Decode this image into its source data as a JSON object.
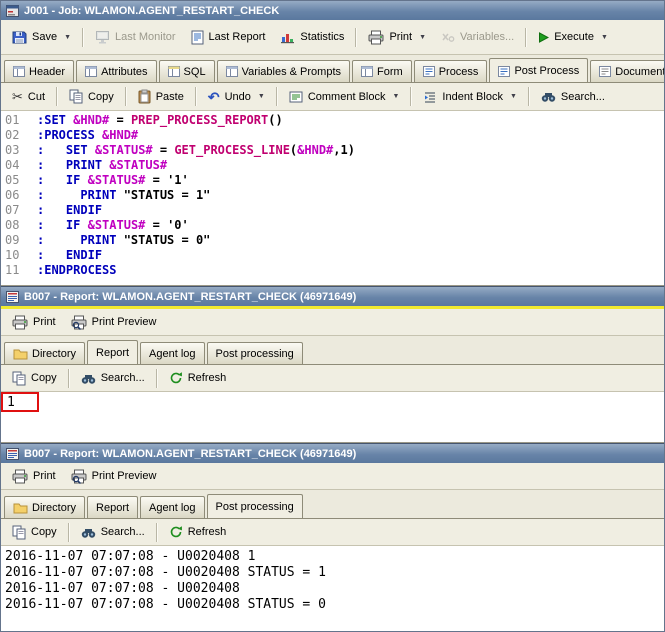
{
  "titlebar": {
    "title": "J001 - Job: WLAMON.AGENT_RESTART_CHECK"
  },
  "main_toolbar": {
    "save": "Save",
    "last_monitor": "Last Monitor",
    "last_report": "Last Report",
    "statistics": "Statistics",
    "print": "Print",
    "variables": "Variables...",
    "execute": "Execute"
  },
  "job_tabs": [
    {
      "label": "Header"
    },
    {
      "label": "Attributes"
    },
    {
      "label": "SQL"
    },
    {
      "label": "Variables & Prompts"
    },
    {
      "label": "Form"
    },
    {
      "label": "Process"
    },
    {
      "label": "Post Process"
    },
    {
      "label": "Documentation"
    }
  ],
  "job_tabs_active": "Post Process",
  "editor_toolbar": {
    "cut": "Cut",
    "copy": "Copy",
    "paste": "Paste",
    "undo": "Undo",
    "comment_block": "Comment Block",
    "indent_block": "Indent Block",
    "search": "Search..."
  },
  "editor": {
    "lines": [
      {
        "no": "01",
        "seg": [
          {
            "t": ":SET",
            "c": "kw"
          },
          {
            "t": " ",
            "c": "pl"
          },
          {
            "t": "&HND#",
            "c": "var"
          },
          {
            "t": " = ",
            "c": "pl"
          },
          {
            "t": "PREP_PROCESS_REPORT",
            "c": "fn"
          },
          {
            "t": "()",
            "c": "pl"
          }
        ]
      },
      {
        "no": "02",
        "seg": [
          {
            "t": ":PROCESS",
            "c": "kw"
          },
          {
            "t": " ",
            "c": "pl"
          },
          {
            "t": "&HND#",
            "c": "var"
          }
        ]
      },
      {
        "no": "03",
        "seg": [
          {
            "t": ":",
            "c": "kw"
          },
          {
            "t": "   ",
            "c": "pl"
          },
          {
            "t": "SET",
            "c": "kw"
          },
          {
            "t": " ",
            "c": "pl"
          },
          {
            "t": "&STATUS#",
            "c": "var"
          },
          {
            "t": " = ",
            "c": "pl"
          },
          {
            "t": "GET_PROCESS_LINE",
            "c": "fn"
          },
          {
            "t": "(",
            "c": "pl"
          },
          {
            "t": "&HND#",
            "c": "var"
          },
          {
            "t": ",1)",
            "c": "pl"
          }
        ]
      },
      {
        "no": "04",
        "seg": [
          {
            "t": ":",
            "c": "kw"
          },
          {
            "t": "   ",
            "c": "pl"
          },
          {
            "t": "PRINT",
            "c": "kw"
          },
          {
            "t": " ",
            "c": "pl"
          },
          {
            "t": "&STATUS#",
            "c": "var"
          }
        ]
      },
      {
        "no": "05",
        "seg": [
          {
            "t": ":",
            "c": "kw"
          },
          {
            "t": "   ",
            "c": "pl"
          },
          {
            "t": "IF",
            "c": "kw"
          },
          {
            "t": " ",
            "c": "pl"
          },
          {
            "t": "&STATUS#",
            "c": "var"
          },
          {
            "t": " = '1'",
            "c": "pl"
          }
        ]
      },
      {
        "no": "06",
        "seg": [
          {
            "t": ":",
            "c": "kw"
          },
          {
            "t": "     ",
            "c": "pl"
          },
          {
            "t": "PRINT",
            "c": "kw"
          },
          {
            "t": " \"STATUS = 1\"",
            "c": "pl"
          }
        ]
      },
      {
        "no": "07",
        "seg": [
          {
            "t": ":",
            "c": "kw"
          },
          {
            "t": "   ",
            "c": "pl"
          },
          {
            "t": "ENDIF",
            "c": "kw"
          }
        ]
      },
      {
        "no": "08",
        "seg": [
          {
            "t": ":",
            "c": "kw"
          },
          {
            "t": "   ",
            "c": "pl"
          },
          {
            "t": "IF",
            "c": "kw"
          },
          {
            "t": " ",
            "c": "pl"
          },
          {
            "t": "&STATUS#",
            "c": "var"
          },
          {
            "t": " = '0'",
            "c": "pl"
          }
        ]
      },
      {
        "no": "09",
        "seg": [
          {
            "t": ":",
            "c": "kw"
          },
          {
            "t": "     ",
            "c": "pl"
          },
          {
            "t": "PRINT",
            "c": "kw"
          },
          {
            "t": " \"STATUS = 0\"",
            "c": "pl"
          }
        ]
      },
      {
        "no": "10",
        "seg": [
          {
            "t": ":",
            "c": "kw"
          },
          {
            "t": "   ",
            "c": "pl"
          },
          {
            "t": "ENDIF",
            "c": "kw"
          }
        ]
      },
      {
        "no": "11",
        "seg": [
          {
            "t": ":ENDPROCESS",
            "c": "kw"
          }
        ]
      }
    ]
  },
  "report_window_1": {
    "title": "B007 - Report: WLAMON.AGENT_RESTART_CHECK (46971649)",
    "toolbar": {
      "print": "Print",
      "print_preview": "Print Preview"
    },
    "tabs": [
      {
        "label": "Directory"
      },
      {
        "label": "Report"
      },
      {
        "label": "Agent log"
      },
      {
        "label": "Post processing"
      }
    ],
    "active_tab": "Report",
    "tools": {
      "copy": "Copy",
      "search": "Search...",
      "refresh": "Refresh"
    },
    "content": "1"
  },
  "report_window_2": {
    "title": "B007 - Report: WLAMON.AGENT_RESTART_CHECK (46971649)",
    "toolbar": {
      "print": "Print",
      "print_preview": "Print Preview"
    },
    "tabs": [
      {
        "label": "Directory"
      },
      {
        "label": "Report"
      },
      {
        "label": "Agent log"
      },
      {
        "label": "Post processing"
      }
    ],
    "active_tab": "Post processing",
    "tools": {
      "copy": "Copy",
      "search": "Search...",
      "refresh": "Refresh"
    },
    "log_lines": [
      "2016-11-07 07:07:08 - U0020408 1",
      "2016-11-07 07:07:08 - U0020408 STATUS = 1",
      "2016-11-07 07:07:08 - U0020408",
      "2016-11-07 07:07:08 - U0020408 STATUS = 0"
    ]
  },
  "icons": {
    "dropdown": "▼",
    "scissors": "✂",
    "undo": "↶"
  }
}
